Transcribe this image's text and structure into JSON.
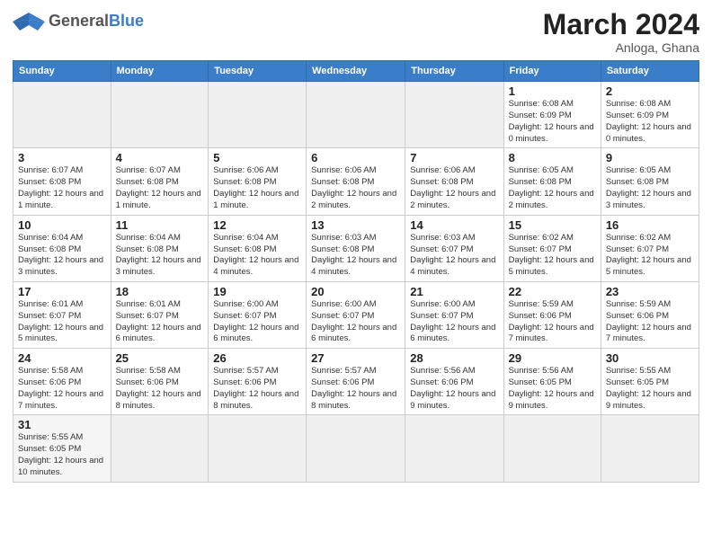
{
  "header": {
    "logo_general": "General",
    "logo_blue": "Blue",
    "month_title": "March 2024",
    "subtitle": "Anloga, Ghana"
  },
  "weekdays": [
    "Sunday",
    "Monday",
    "Tuesday",
    "Wednesday",
    "Thursday",
    "Friday",
    "Saturday"
  ],
  "weeks": [
    [
      {
        "day": "",
        "info": ""
      },
      {
        "day": "",
        "info": ""
      },
      {
        "day": "",
        "info": ""
      },
      {
        "day": "",
        "info": ""
      },
      {
        "day": "",
        "info": ""
      },
      {
        "day": "1",
        "info": "Sunrise: 6:08 AM\nSunset: 6:09 PM\nDaylight: 12 hours\nand 0 minutes."
      },
      {
        "day": "2",
        "info": "Sunrise: 6:08 AM\nSunset: 6:09 PM\nDaylight: 12 hours\nand 0 minutes."
      }
    ],
    [
      {
        "day": "3",
        "info": "Sunrise: 6:07 AM\nSunset: 6:08 PM\nDaylight: 12 hours\nand 1 minute."
      },
      {
        "day": "4",
        "info": "Sunrise: 6:07 AM\nSunset: 6:08 PM\nDaylight: 12 hours\nand 1 minute."
      },
      {
        "day": "5",
        "info": "Sunrise: 6:06 AM\nSunset: 6:08 PM\nDaylight: 12 hours\nand 1 minute."
      },
      {
        "day": "6",
        "info": "Sunrise: 6:06 AM\nSunset: 6:08 PM\nDaylight: 12 hours\nand 2 minutes."
      },
      {
        "day": "7",
        "info": "Sunrise: 6:06 AM\nSunset: 6:08 PM\nDaylight: 12 hours\nand 2 minutes."
      },
      {
        "day": "8",
        "info": "Sunrise: 6:05 AM\nSunset: 6:08 PM\nDaylight: 12 hours\nand 2 minutes."
      },
      {
        "day": "9",
        "info": "Sunrise: 6:05 AM\nSunset: 6:08 PM\nDaylight: 12 hours\nand 3 minutes."
      }
    ],
    [
      {
        "day": "10",
        "info": "Sunrise: 6:04 AM\nSunset: 6:08 PM\nDaylight: 12 hours\nand 3 minutes."
      },
      {
        "day": "11",
        "info": "Sunrise: 6:04 AM\nSunset: 6:08 PM\nDaylight: 12 hours\nand 3 minutes."
      },
      {
        "day": "12",
        "info": "Sunrise: 6:04 AM\nSunset: 6:08 PM\nDaylight: 12 hours\nand 4 minutes."
      },
      {
        "day": "13",
        "info": "Sunrise: 6:03 AM\nSunset: 6:08 PM\nDaylight: 12 hours\nand 4 minutes."
      },
      {
        "day": "14",
        "info": "Sunrise: 6:03 AM\nSunset: 6:07 PM\nDaylight: 12 hours\nand 4 minutes."
      },
      {
        "day": "15",
        "info": "Sunrise: 6:02 AM\nSunset: 6:07 PM\nDaylight: 12 hours\nand 5 minutes."
      },
      {
        "day": "16",
        "info": "Sunrise: 6:02 AM\nSunset: 6:07 PM\nDaylight: 12 hours\nand 5 minutes."
      }
    ],
    [
      {
        "day": "17",
        "info": "Sunrise: 6:01 AM\nSunset: 6:07 PM\nDaylight: 12 hours\nand 5 minutes."
      },
      {
        "day": "18",
        "info": "Sunrise: 6:01 AM\nSunset: 6:07 PM\nDaylight: 12 hours\nand 6 minutes."
      },
      {
        "day": "19",
        "info": "Sunrise: 6:00 AM\nSunset: 6:07 PM\nDaylight: 12 hours\nand 6 minutes."
      },
      {
        "day": "20",
        "info": "Sunrise: 6:00 AM\nSunset: 6:07 PM\nDaylight: 12 hours\nand 6 minutes."
      },
      {
        "day": "21",
        "info": "Sunrise: 6:00 AM\nSunset: 6:07 PM\nDaylight: 12 hours\nand 6 minutes."
      },
      {
        "day": "22",
        "info": "Sunrise: 5:59 AM\nSunset: 6:06 PM\nDaylight: 12 hours\nand 7 minutes."
      },
      {
        "day": "23",
        "info": "Sunrise: 5:59 AM\nSunset: 6:06 PM\nDaylight: 12 hours\nand 7 minutes."
      }
    ],
    [
      {
        "day": "24",
        "info": "Sunrise: 5:58 AM\nSunset: 6:06 PM\nDaylight: 12 hours\nand 7 minutes."
      },
      {
        "day": "25",
        "info": "Sunrise: 5:58 AM\nSunset: 6:06 PM\nDaylight: 12 hours\nand 8 minutes."
      },
      {
        "day": "26",
        "info": "Sunrise: 5:57 AM\nSunset: 6:06 PM\nDaylight: 12 hours\nand 8 minutes."
      },
      {
        "day": "27",
        "info": "Sunrise: 5:57 AM\nSunset: 6:06 PM\nDaylight: 12 hours\nand 8 minutes."
      },
      {
        "day": "28",
        "info": "Sunrise: 5:56 AM\nSunset: 6:06 PM\nDaylight: 12 hours\nand 9 minutes."
      },
      {
        "day": "29",
        "info": "Sunrise: 5:56 AM\nSunset: 6:05 PM\nDaylight: 12 hours\nand 9 minutes."
      },
      {
        "day": "30",
        "info": "Sunrise: 5:55 AM\nSunset: 6:05 PM\nDaylight: 12 hours\nand 9 minutes."
      }
    ],
    [
      {
        "day": "31",
        "info": "Sunrise: 5:55 AM\nSunset: 6:05 PM\nDaylight: 12 hours\nand 10 minutes."
      },
      {
        "day": "",
        "info": ""
      },
      {
        "day": "",
        "info": ""
      },
      {
        "day": "",
        "info": ""
      },
      {
        "day": "",
        "info": ""
      },
      {
        "day": "",
        "info": ""
      },
      {
        "day": "",
        "info": ""
      }
    ]
  ]
}
